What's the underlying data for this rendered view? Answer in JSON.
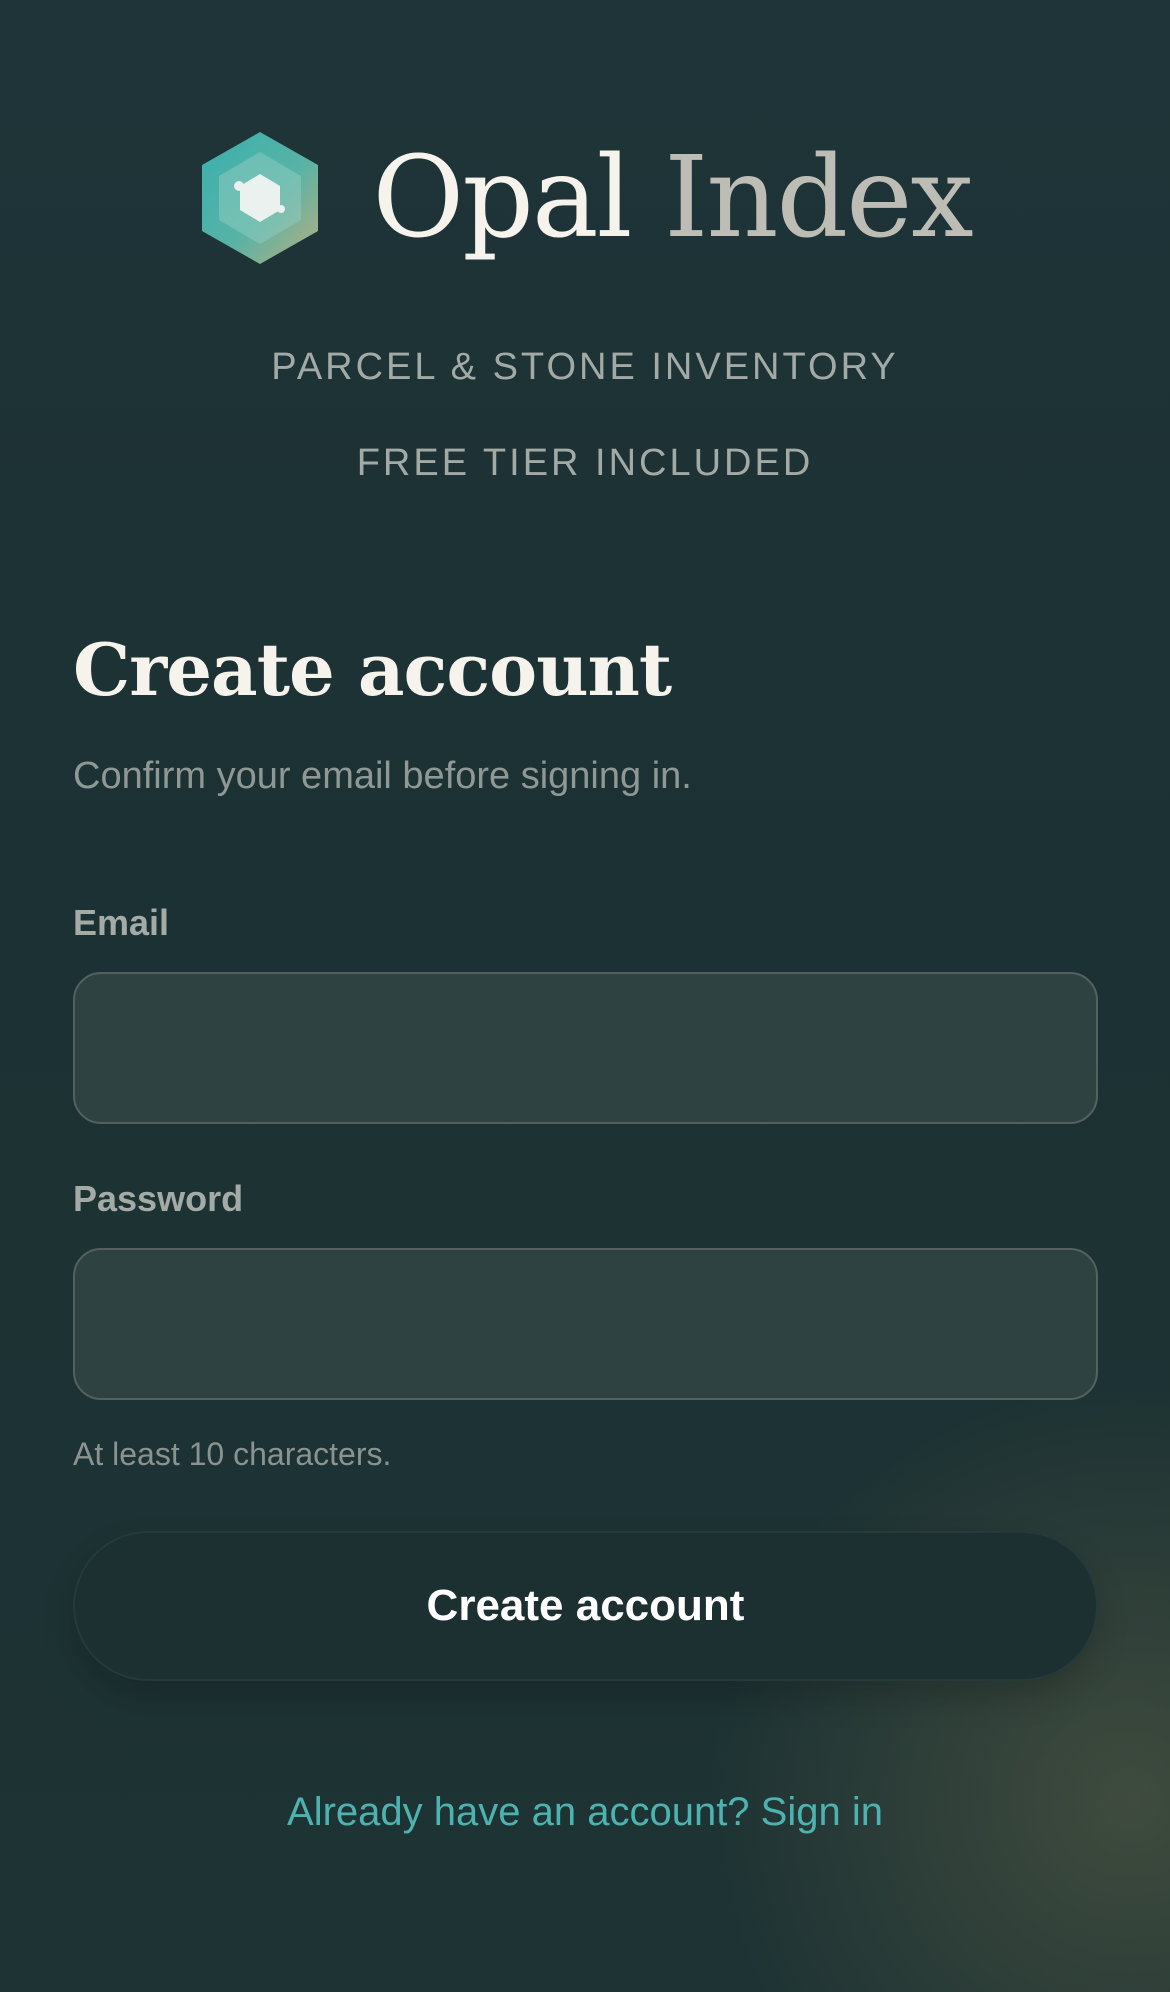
{
  "brand": {
    "name_primary": "Opal",
    "name_secondary": "Index",
    "tagline": "PARCEL & STONE INVENTORY",
    "tier": "FREE TIER INCLUDED"
  },
  "form": {
    "title": "Create account",
    "subtitle": "Confirm your email before signing in.",
    "email_label": "Email",
    "email_value": "",
    "password_label": "Password",
    "password_value": "",
    "password_hint": "At least 10 characters.",
    "submit_label": "Create account"
  },
  "footer": {
    "signin_link": "Already have an account? Sign in"
  },
  "icons": {
    "logo": "opal-hexagon-icon"
  },
  "colors": {
    "accent": "#4db3b0",
    "background": "#1e3335",
    "button": "#1c3032"
  }
}
